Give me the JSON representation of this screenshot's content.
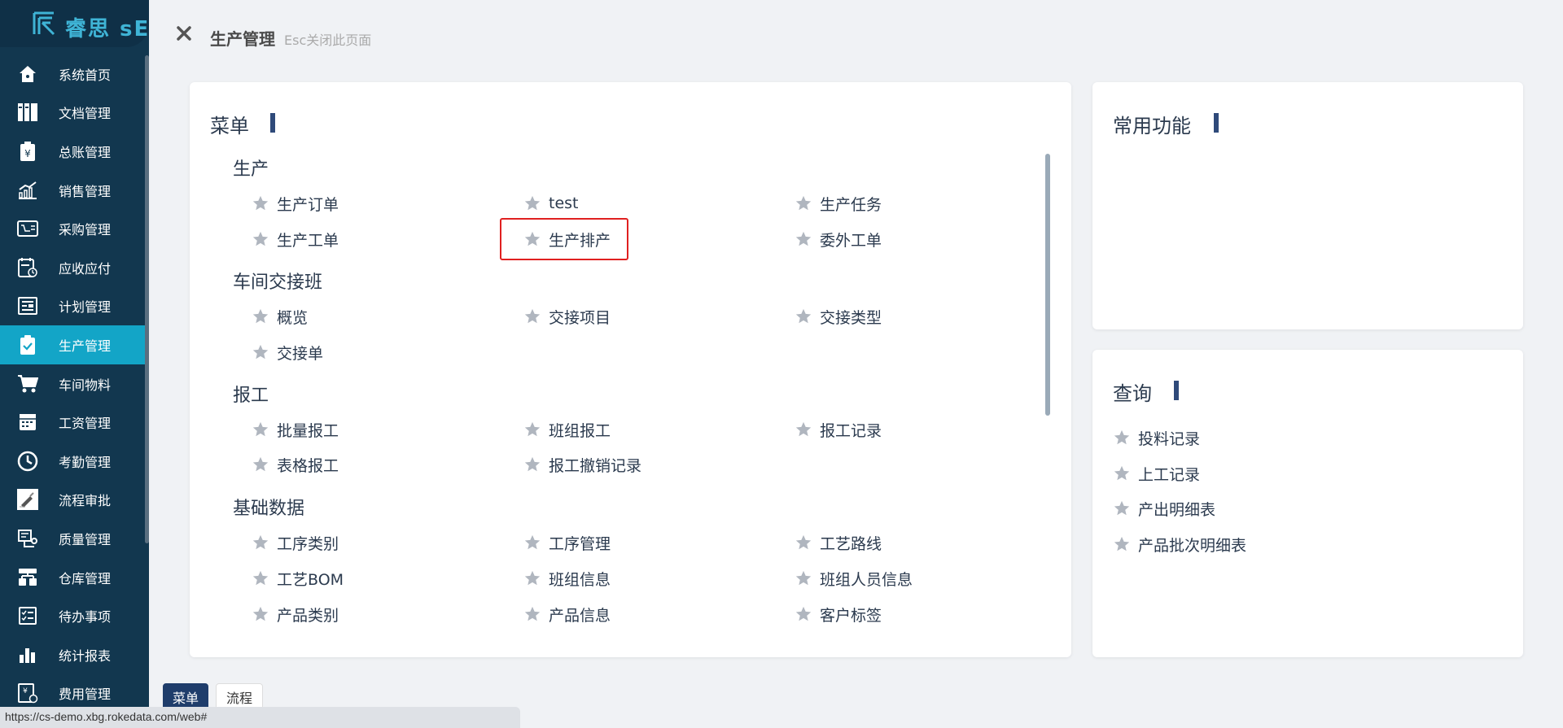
{
  "app": {
    "logo_text": "睿思 sERP"
  },
  "sidebar": {
    "items": [
      {
        "label": "系统首页",
        "icon": "home-icon"
      },
      {
        "label": "文档管理",
        "icon": "document-icon"
      },
      {
        "label": "总账管理",
        "icon": "ledger-icon"
      },
      {
        "label": "销售管理",
        "icon": "sales-chart-icon"
      },
      {
        "label": "采购管理",
        "icon": "purchase-icon"
      },
      {
        "label": "应收应付",
        "icon": "receivable-icon"
      },
      {
        "label": "计划管理",
        "icon": "plan-icon"
      },
      {
        "label": "生产管理",
        "icon": "production-icon",
        "active": true
      },
      {
        "label": "车间物料",
        "icon": "cart-icon"
      },
      {
        "label": "工资管理",
        "icon": "salary-icon"
      },
      {
        "label": "考勤管理",
        "icon": "clock-icon"
      },
      {
        "label": "流程审批",
        "icon": "approval-icon"
      },
      {
        "label": "质量管理",
        "icon": "quality-icon"
      },
      {
        "label": "仓库管理",
        "icon": "warehouse-icon"
      },
      {
        "label": "待办事项",
        "icon": "todo-icon"
      },
      {
        "label": "统计报表",
        "icon": "bar-chart-icon"
      },
      {
        "label": "费用管理",
        "icon": "expense-icon"
      }
    ]
  },
  "header": {
    "title": "生产管理",
    "hint": "Esc关闭此页面"
  },
  "menu_panel": {
    "title": "菜单",
    "sections": [
      {
        "title": "生产",
        "items": [
          "生产订单",
          "test",
          "生产任务",
          "生产工单",
          "生产排产",
          "委外工单"
        ]
      },
      {
        "title": "车间交接班",
        "items": [
          "概览",
          "交接项目",
          "交接类型",
          "交接单"
        ]
      },
      {
        "title": "报工",
        "items": [
          "批量报工",
          "班组报工",
          "报工记录",
          "表格报工",
          "报工撤销记录"
        ]
      },
      {
        "title": "基础数据",
        "items": [
          "工序类别",
          "工序管理",
          "工艺路线",
          "工艺BOM",
          "班组信息",
          "班组人员信息",
          "产品类别",
          "产品信息",
          "客户标签"
        ]
      }
    ]
  },
  "fav_panel": {
    "title": "常用功能"
  },
  "query_panel": {
    "title": "查询",
    "items": [
      "投料记录",
      "上工记录",
      "产出明细表",
      "产品批次明细表"
    ]
  },
  "bottom_tabs": {
    "menu": "菜单",
    "process": "流程"
  },
  "status_url": "https://cs-demo.xbg.rokedata.com/web#",
  "colors": {
    "sidebar_bg": "#12374f",
    "sidebar_active": "#13a5c7",
    "accent_bar": "#2f4a7a",
    "highlight": "#e02020"
  }
}
